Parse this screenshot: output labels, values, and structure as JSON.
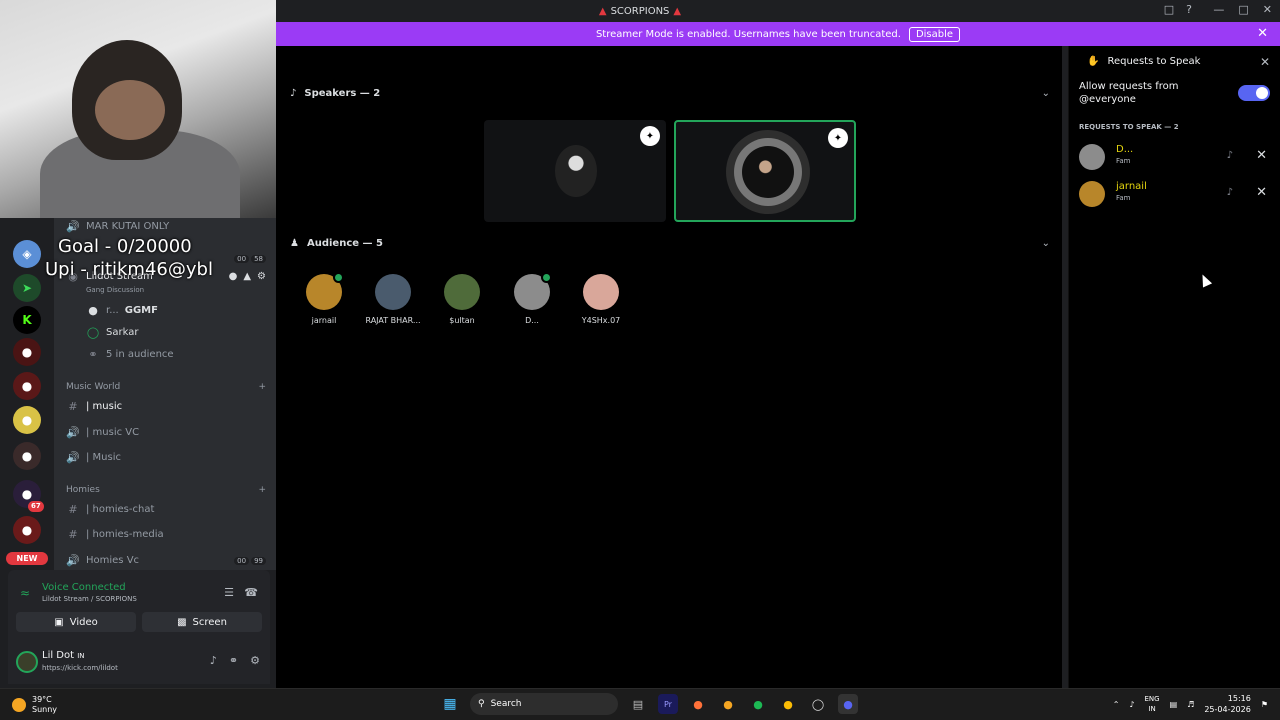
{
  "titlebar": {
    "title": "SCORPIONS"
  },
  "banner": {
    "text": "Streamer Mode is enabled. Usernames have been truncated.",
    "disable_label": "Disable"
  },
  "overlay": {
    "goal": "Goal - 0/20000",
    "upi": "Upi - ritikm46@ybl"
  },
  "server_rail": {
    "new_badge": "NEW",
    "count_badge": "67"
  },
  "channels": {
    "mar_kutai": "MAR KUTAI ONLY",
    "lildot_stream": "Lildot Stream",
    "gang_discussion": "Gang Discussion",
    "speaker_1": "GGMF",
    "speaker_1_prefix": "r...",
    "speaker_2": "Sarkar",
    "in_audience": "5 in audience",
    "cat_music_world": "Music World",
    "music": "| music",
    "music_vc": "| music VC",
    "music_stage": "| Music",
    "cat_homies": "Homies",
    "homies_chat": "| homies-chat",
    "homies_media": "| homies-media",
    "homies_vc": "Homies Vc",
    "pill_a1": "00",
    "pill_a2": "58",
    "pill_b1": "00",
    "pill_b2": "99"
  },
  "voice": {
    "status": "Voice Connected",
    "location": "Lildot Stream / SCORPIONS",
    "video_label": "Video",
    "screen_label": "Screen"
  },
  "user": {
    "name": "Lil Dot",
    "suffix": "IN",
    "status": "https://kick.com/lildot"
  },
  "stage": {
    "speakers_title": "Speakers — 2",
    "audience_title": "Audience — 5",
    "audience": [
      {
        "name": "jarnail",
        "color": "#b8862a"
      },
      {
        "name": "RAJAT BHAR...",
        "color": "#4a5b6d"
      },
      {
        "name": "$ultan",
        "color": "#4f6b3a"
      },
      {
        "name": "D...",
        "color": "#8c8c8c"
      },
      {
        "name": "Y4SHx.07",
        "color": "#d9a79a"
      }
    ]
  },
  "requests": {
    "title": "Requests to Speak",
    "allow_text": "Allow requests from @everyone",
    "section_label": "REQUESTS TO SPEAK — 2",
    "items": [
      {
        "name": "D...",
        "role": "Fam",
        "color": "#8c8c8c"
      },
      {
        "name": "jarnail",
        "role": "Fam",
        "color": "#b8862a"
      }
    ]
  },
  "taskbar": {
    "temp": "39°C",
    "weather": "Sunny",
    "search": "Search",
    "lang_1": "ENG",
    "lang_2": "IN",
    "time": "15:16",
    "date": "25-04-2026"
  },
  "colors": {
    "streamer_banner": "#9b3bf5",
    "online": "#23a55a",
    "toggle": "#5865f2"
  }
}
